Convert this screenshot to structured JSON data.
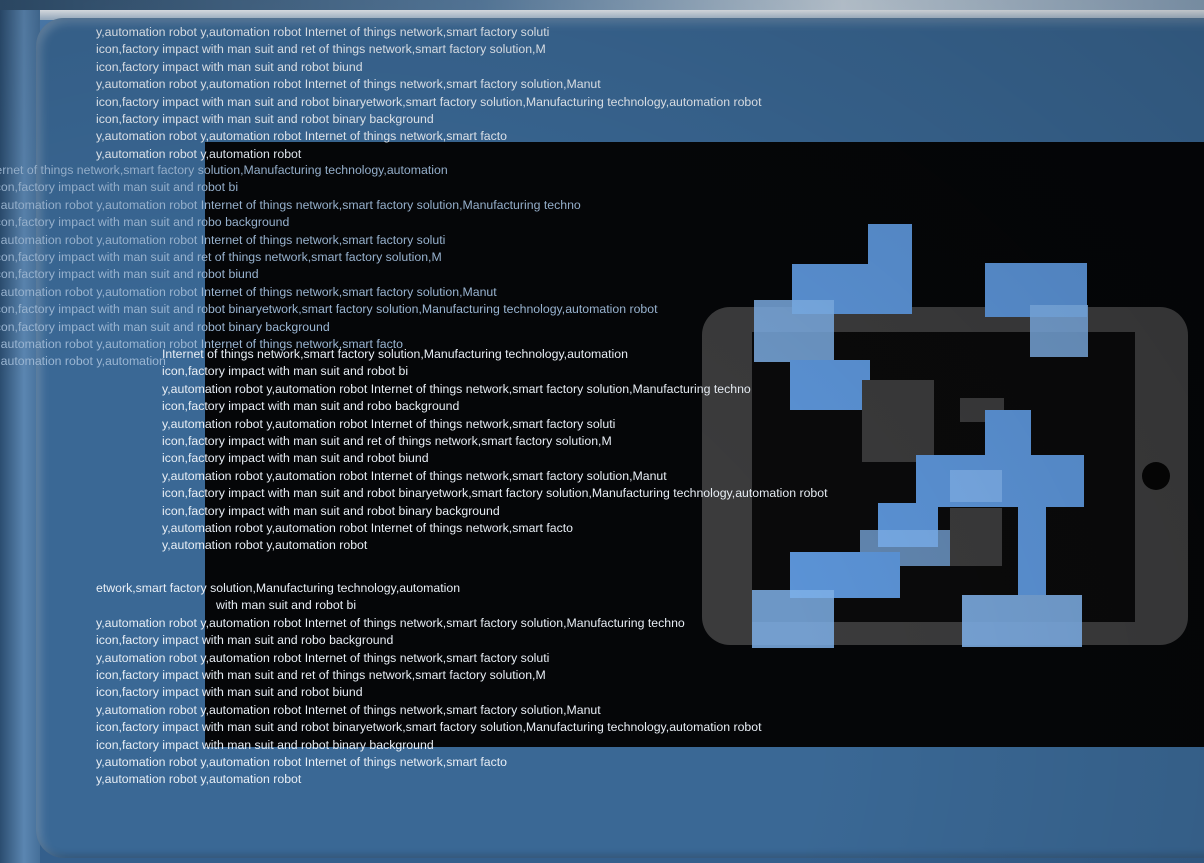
{
  "text_blocks": {
    "block1": [
      "y,automation robot y,automation robot Internet of things network,smart factory soluti",
      "icon,factory impact with man suit and ret of things network,smart factory solution,M",
      "icon,factory impact with man suit and robot biund",
      "y,automation robot y,automation robot Internet of things network,smart factory solution,Manut",
      "icon,factory impact with man suit and robot binaryetwork,smart factory solution,Manufacturing  technology,automation robot",
      "icon,factory impact with man suit and robot binary background",
      "y,automation robot y,automation robot Internet of things network,smart facto",
      "y,automation robot y,automation robot"
    ],
    "block2": [
      "ternet of things network,smart factory solution,Manufacturing  technology,automation",
      "icon,factory impact with man suit and robot bi",
      "y,automation robot y,automation robot Internet of things network,smart factory solution,Manufacturing  techno",
      "icon,factory impact with man suit and robo background",
      "y,automation robot y,automation robot Internet of things network,smart factory soluti",
      "icon,factory impact with man suit and ret of things network,smart factory solution,M",
      "icon,factory impact with man suit and robot biund",
      "y,automation robot y,automation robot Internet of things network,smart factory solution,Manut",
      "icon,factory impact with man suit and robot binaryetwork,smart factory solution,Manufacturing  technology,automation robot",
      "icon,factory impact with man suit and robot binary background",
      "y,automation robot y,automation robot Internet of things network,smart facto",
      "y,automation robot y,automation"
    ],
    "block3": [
      "Internet of things network,smart factory solution,Manufacturing  technology,automation",
      "icon,factory impact with man suit and robot bi",
      "y,automation robot y,automation robot Internet of things network,smart factory solution,Manufacturing  techno",
      "icon,factory impact with man suit and robo background",
      "y,automation robot y,automation robot Internet of things network,smart factory soluti",
      "icon,factory impact with man suit and ret of things network,smart factory solution,M",
      "icon,factory impact with man suit and robot biund",
      "y,automation robot y,automation robot Internet of things network,smart factory solution,Manut",
      "icon,factory impact with man suit and robot binaryetwork,smart factory solution,Manufacturing  technology,automation robot",
      "icon,factory impact with man suit and robot binary background",
      "y,automation robot y,automation robot Internet of things network,smart facto",
      "y,automation robot y,automation robot"
    ],
    "block4": [
      "etwork,smart factory solution,Manufacturing  technology,automation",
      "with man suit and robot bi",
      "y,automation robot y,automation robot Internet of things network,smart factory solution,Manufacturing  techno",
      "icon,factory impact with man suit and robo background",
      "y,automation robot y,automation robot Internet of things network,smart factory soluti",
      "icon,factory impact with man suit and ret of things network,smart factory solution,M",
      "icon,factory impact with man suit and robot biund",
      "y,automation robot y,automation robot Internet of things network,smart factory solution,Manut",
      "icon,factory impact with man suit and robot binaryetwork,smart factory solution,Manufacturing  technology,automation robot",
      "icon,factory impact with man suit and robot binary background",
      "y,automation robot y,automation robot Internet of things network,smart facto",
      "y,automation robot y,automation robot"
    ]
  },
  "colors": {
    "screen_blue": "#3f6c99",
    "dark_panel": "#050608",
    "tablet_gray": "#3b3b3c",
    "pixel_blue": "#5b93d6",
    "pixel_light": "#7fb0e8",
    "text": "#e8eef5"
  },
  "icons": {
    "tablet": "tablet-icon",
    "pixel_robot": "pixel-robot-icon"
  }
}
